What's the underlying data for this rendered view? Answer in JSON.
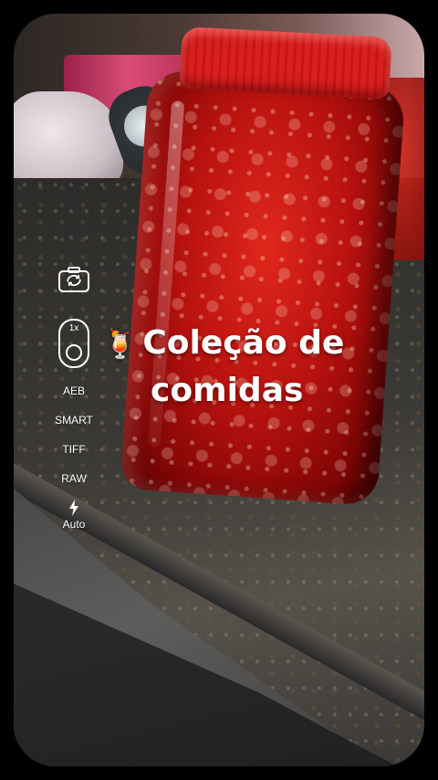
{
  "camera": {
    "zoom_label": "1x",
    "modes": [
      "AEB",
      "SMART",
      "TIFF",
      "RAW"
    ],
    "flash_label": "Auto"
  },
  "caption": {
    "emoji": "🍹",
    "line1": "Coleção de",
    "line2": "comidas"
  },
  "colors": {
    "frame": "#000000",
    "jar_red": "#c41616",
    "text": "#ffffff"
  },
  "icons": {
    "flip": "camera-flip-icon",
    "zoom": "lens-zoom-icon",
    "flash": "flash-bolt-icon"
  }
}
